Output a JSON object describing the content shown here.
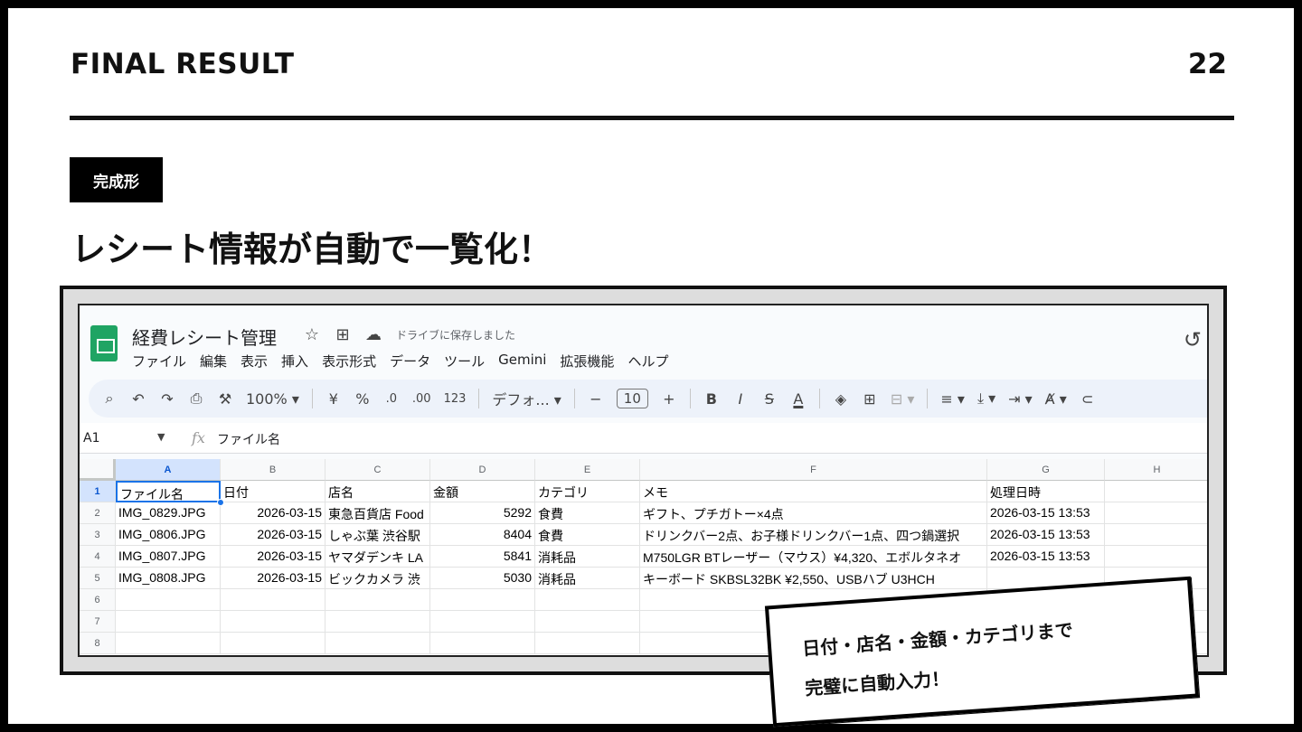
{
  "slide": {
    "title": "FINAL RESULT",
    "page_number": "22",
    "badge": "完成形",
    "headline": "レシート情報が自動で一覧化！"
  },
  "sheets": {
    "doc_title": "経費レシート管理",
    "save_status": "ドライブに保存しました",
    "icons": [
      "star-icon",
      "move-folder-icon",
      "cloud-saved-icon",
      "history-icon"
    ],
    "menu": [
      "ファイル",
      "編集",
      "表示",
      "挿入",
      "表示形式",
      "データ",
      "ツール",
      "Gemini",
      "拡張機能",
      "ヘルプ"
    ],
    "toolbar": {
      "zoom": "100%",
      "currency": "¥",
      "percent": "%",
      "decrease_decimal": ".0",
      "increase_decimal": ".00",
      "number_format": "123",
      "font": "デフォ...",
      "font_size": "10",
      "bold": "B",
      "italic": "I",
      "strike": "S",
      "text_color": "A",
      "minus": "−",
      "plus": "+"
    },
    "formula_bar": {
      "cell_ref": "A1",
      "fx": "fx",
      "value": "ファイル名"
    },
    "columns": [
      "A",
      "B",
      "C",
      "D",
      "E",
      "F",
      "G",
      "H"
    ],
    "row_numbers": [
      "1",
      "2",
      "3",
      "4",
      "5",
      "6",
      "7",
      "8"
    ],
    "rows": [
      [
        "ファイル名",
        "日付",
        "店名",
        "金額",
        "カテゴリ",
        "メモ",
        "処理日時",
        ""
      ],
      [
        "IMG_0829.JPG",
        "2026-03-15",
        "東急百貨店 Food",
        "5292",
        "食費",
        "ギフト、プチガトー×4点",
        "2026-03-15 13:53",
        ""
      ],
      [
        "IMG_0806.JPG",
        "2026-03-15",
        "しゃぶ葉 渋谷駅",
        "8404",
        "食費",
        "ドリンクバー2点、お子様ドリンクバー1点、四つ鍋選択",
        "2026-03-15 13:53",
        ""
      ],
      [
        "IMG_0807.JPG",
        "2026-03-15",
        "ヤマダデンキ LA",
        "5841",
        "消耗品",
        "M750LGR BTレーザー（マウス）¥4,320、エボルタネオ",
        "2026-03-15 13:53",
        ""
      ],
      [
        "IMG_0808.JPG",
        "2026-03-15",
        "ビックカメラ 渋",
        "5030",
        "消耗品",
        "キーボード SKBSL32BK ¥2,550、USBハブ U3HCH",
        "",
        ""
      ]
    ]
  },
  "callout": {
    "line1": "日付・店名・金額・カテゴリまで",
    "line2": "完璧に自動入力！"
  },
  "colors": {
    "sheets_green": "#1fa463",
    "selection_blue": "#1a73e8",
    "toolbar_bg": "#edf2fa"
  }
}
